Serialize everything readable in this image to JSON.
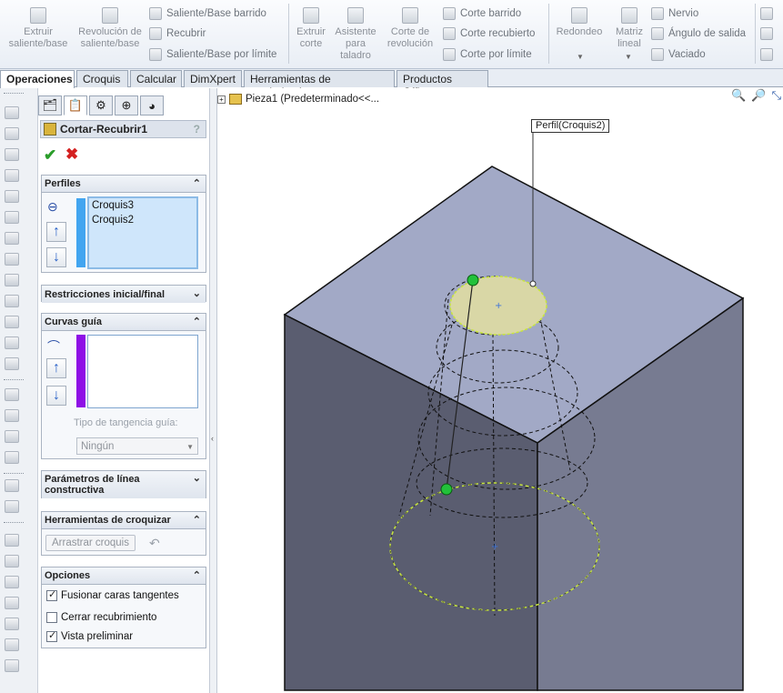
{
  "ribbon": {
    "extruir_saliente": "Extruir saliente/base",
    "revolucion_saliente": "Revolución de saliente/base",
    "saliente_barrido": "Saliente/Base barrido",
    "recubrir": "Recubrir",
    "saliente_limite": "Saliente/Base por límite",
    "extruir_corte": "Extruir corte",
    "asistente_taladro": "Asistente para taladro",
    "corte_revolucion": "Corte de revolución",
    "corte_barrido": "Corte barrido",
    "corte_recubierto": "Corte recubierto",
    "corte_limite": "Corte por límite",
    "redondeo": "Redondeo",
    "matriz_lineal": "Matriz lineal",
    "nervio": "Nervio",
    "angulo_salida": "Ángulo de salida",
    "vaciado": "Vaciado"
  },
  "tabs": [
    "Operaciones",
    "Croquis",
    "Calcular",
    "DimXpert",
    "Herramientas de renderizado",
    "Productos Office"
  ],
  "pm": {
    "title": "Cortar-Recubrir1",
    "help": "?",
    "groups": {
      "perfiles": "Perfiles",
      "restricciones": "Restricciones inicial/final",
      "curvas_guia": "Curvas guía",
      "parametros": "Parámetros de línea constructiva",
      "herramientas": "Herramientas de croquizar",
      "opciones": "Opciones"
    },
    "perfiles_items": [
      "Croquis3",
      "Croquis2"
    ],
    "tipo_tangencia_label": "Tipo de tangencia guía:",
    "tipo_tangencia_value": "Ningún",
    "arrastrar_croquis": "Arrastrar croquis",
    "opciones": [
      {
        "label": "Fusionar caras tangentes",
        "checked": true
      },
      {
        "label": "Cerrar recubrimiento",
        "checked": false
      },
      {
        "label": "Vista preliminar",
        "checked": true
      }
    ]
  },
  "viewport": {
    "tree_label": "Pieza1  (Predeterminado<<...",
    "callout": "Perfil(Croquis2)"
  },
  "colors": {
    "block_top": "#a2a9c6",
    "block_left": "#5a5d70",
    "block_right": "#777b91",
    "profile_fill": "#d9d7a6",
    "profile_edge": "#c8e63c",
    "point_green": "#22c13a"
  }
}
